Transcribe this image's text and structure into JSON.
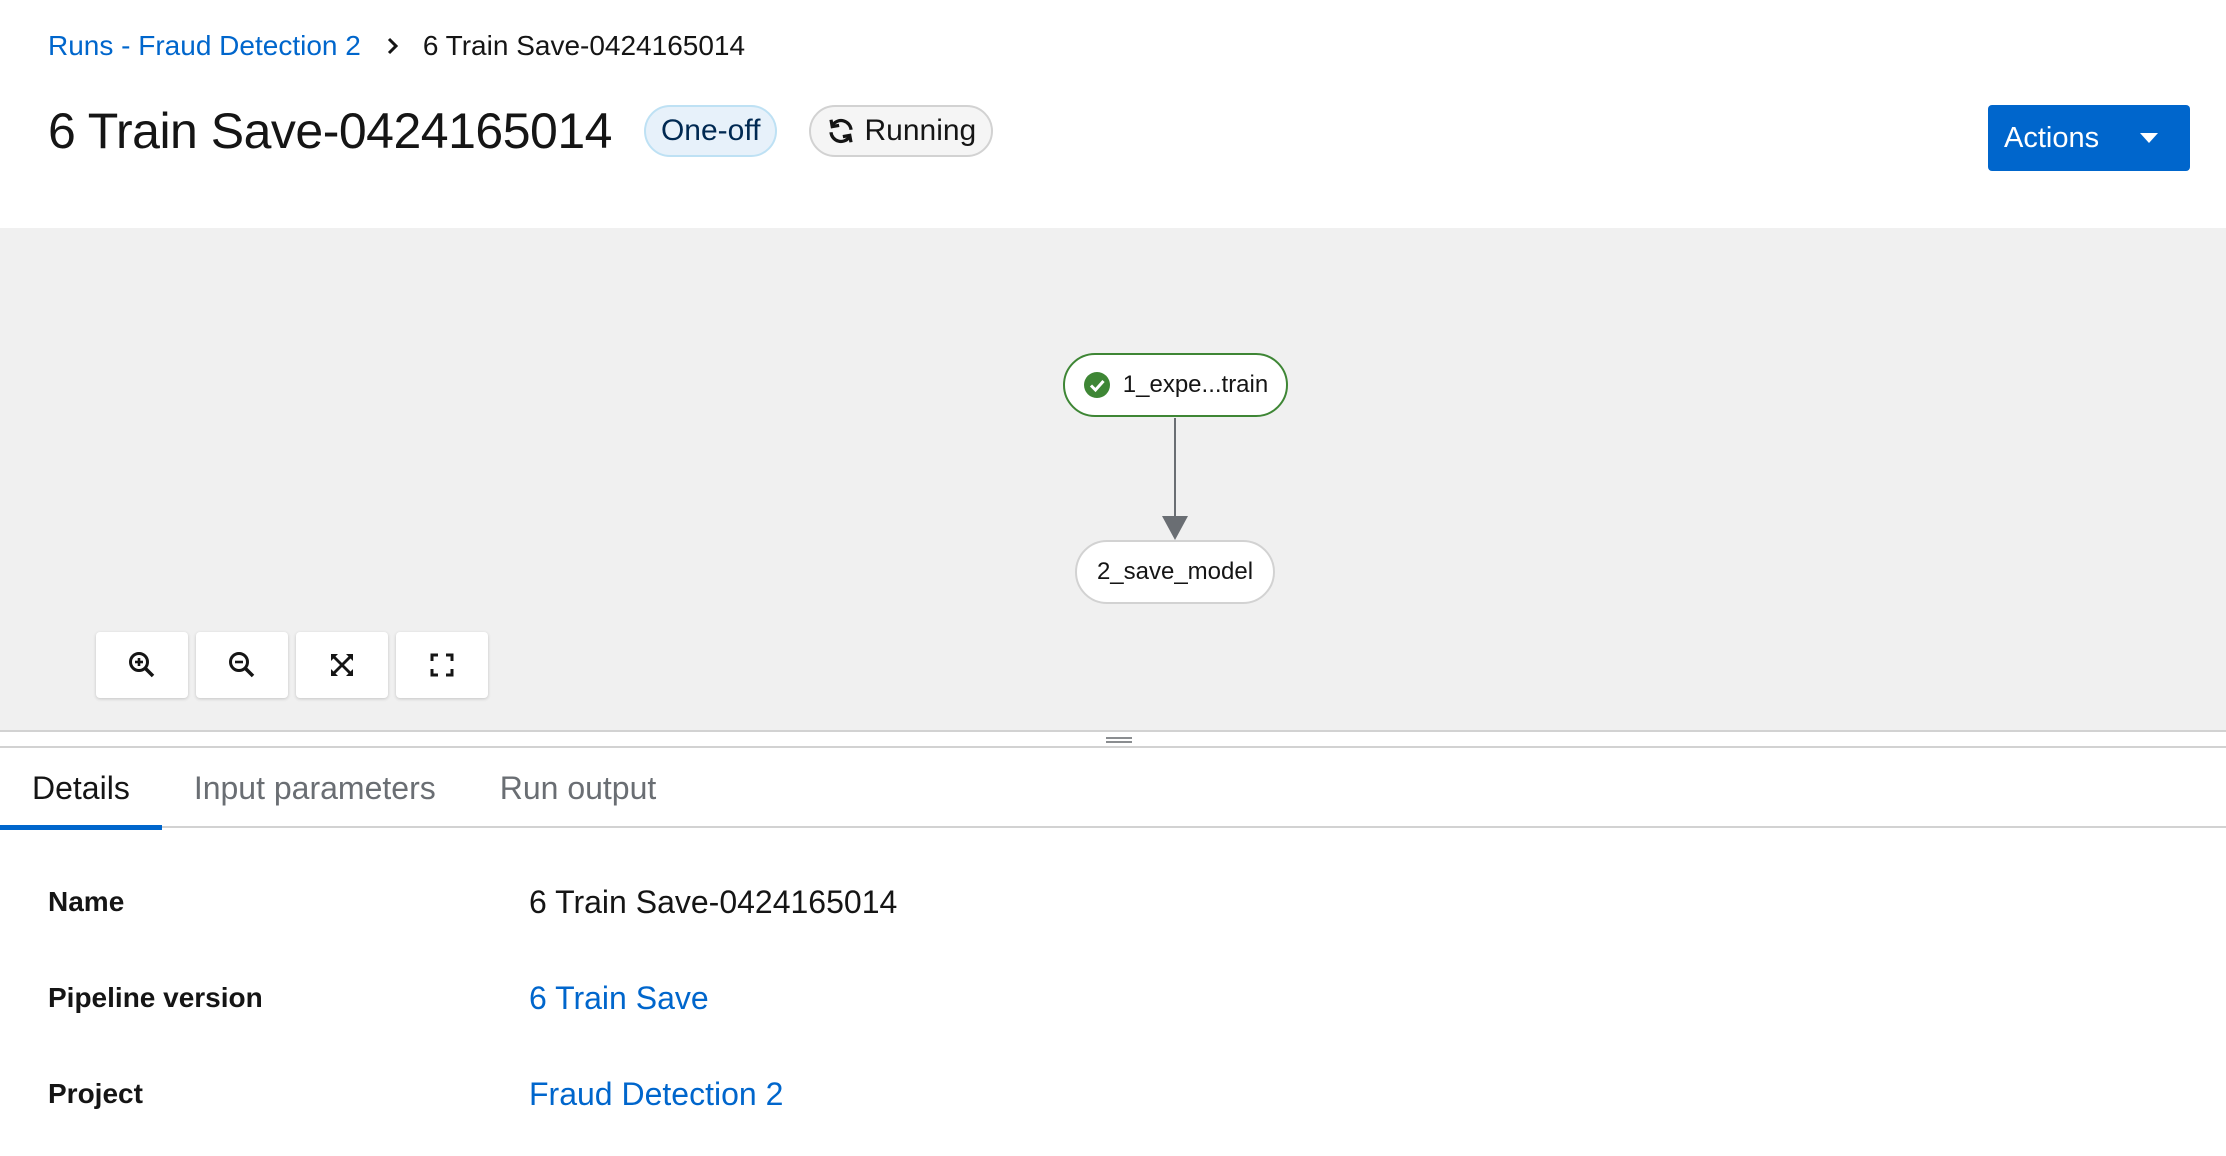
{
  "breadcrumb": {
    "parent": "Runs - Fraud Detection 2",
    "current": "6 Train Save-0424165014"
  },
  "header": {
    "title": "6 Train Save-0424165014",
    "type_label": "One-off",
    "status_label": "Running",
    "actions_label": "Actions"
  },
  "graph": {
    "nodes": [
      {
        "label": "1_expe...train",
        "status": "succeeded"
      },
      {
        "label": "2_save_model",
        "status": "pending"
      }
    ],
    "controls": [
      "zoom-in-icon",
      "zoom-out-icon",
      "fit-to-screen-icon",
      "reset-view-icon"
    ]
  },
  "tabs": [
    {
      "label": "Details",
      "active": true
    },
    {
      "label": "Input parameters",
      "active": false
    },
    {
      "label": "Run output",
      "active": false
    }
  ],
  "details": {
    "name_term": "Name",
    "name_value": "6 Train Save-0424165014",
    "pipeline_term": "Pipeline version",
    "pipeline_value": "6 Train Save",
    "project_term": "Project",
    "project_value": "Fraud Detection 2"
  },
  "colors": {
    "accent": "#0066cc",
    "success": "#3e8635",
    "graph_background": "#f0f0f0"
  }
}
